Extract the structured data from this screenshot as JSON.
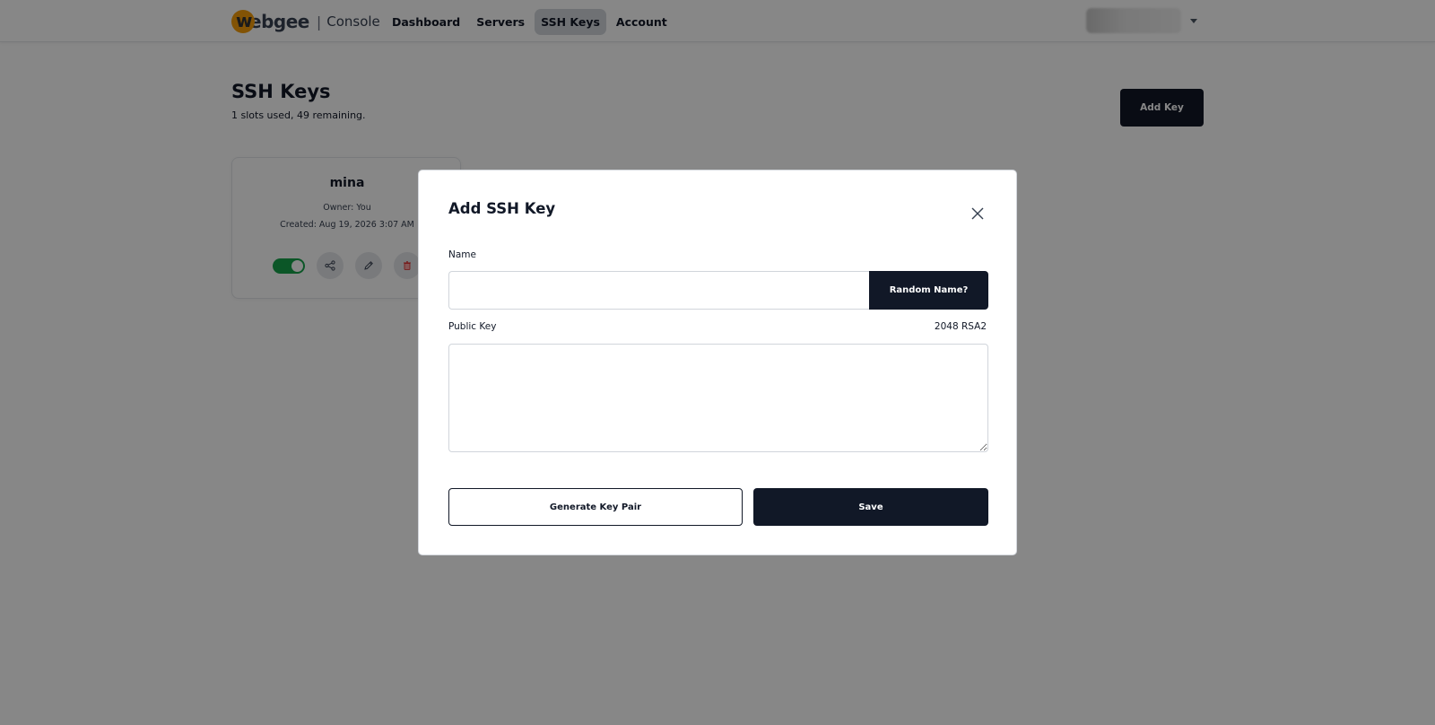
{
  "header": {
    "logo_text": "ebgee",
    "logo_initial": "w",
    "console_label": "Console",
    "nav": [
      {
        "label": "Dashboard",
        "active": false
      },
      {
        "label": "Servers",
        "active": false
      },
      {
        "label": "SSH Keys",
        "active": true
      },
      {
        "label": "Account",
        "active": false
      }
    ]
  },
  "page": {
    "title": "SSH Keys",
    "subtitle": "1 slots used, 49 remaining.",
    "add_key_label": "Add Key"
  },
  "keys": [
    {
      "name": "mina",
      "owner": "Owner: You",
      "created": "Created: Aug 19, 2026 3:07 AM",
      "enabled": true
    }
  ],
  "modal": {
    "title": "Add SSH Key",
    "name_label": "Name",
    "name_value": "",
    "random_name_label": "Random Name?",
    "public_key_label": "Public Key",
    "key_type": "2048 RSA2",
    "public_key_value": "",
    "generate_label": "Generate Key Pair",
    "save_label": "Save"
  },
  "colors": {
    "primary": "#111827",
    "toggle_on": "#16a34a",
    "logo_accent": "#f59e0b"
  }
}
